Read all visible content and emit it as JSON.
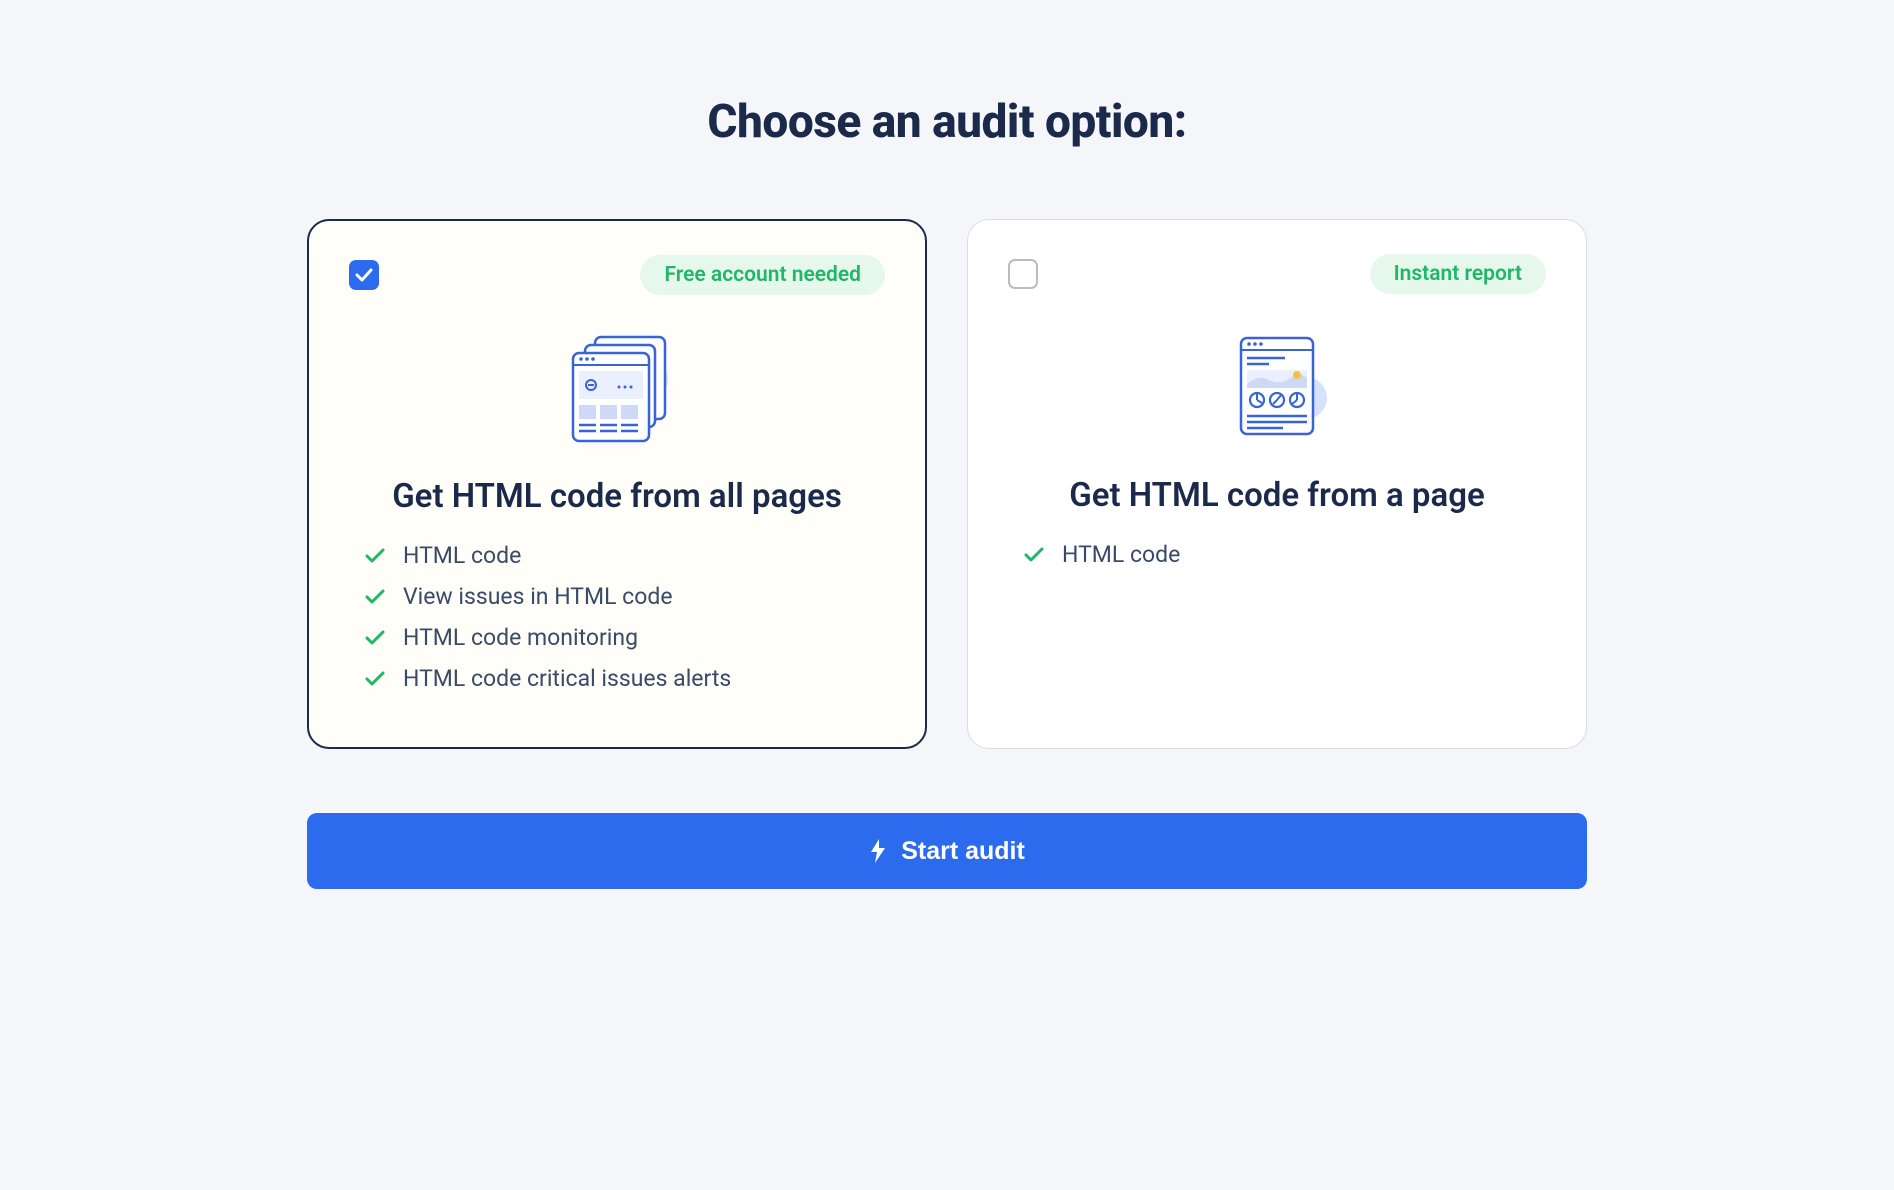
{
  "title": "Choose an audit option:",
  "cards": [
    {
      "badge": "Free account needed",
      "title": "Get HTML code from all pages",
      "selected": true,
      "features": [
        "HTML code",
        "View issues in HTML code",
        "HTML code monitoring",
        "HTML code critical issues alerts"
      ]
    },
    {
      "badge": "Instant report",
      "title": "Get HTML code from a page",
      "selected": false,
      "features": [
        "HTML code"
      ]
    }
  ],
  "cta_label": "Start audit",
  "colors": {
    "accent": "#2c6bed",
    "success": "#1fb866",
    "text_dark": "#1b2a4a"
  }
}
